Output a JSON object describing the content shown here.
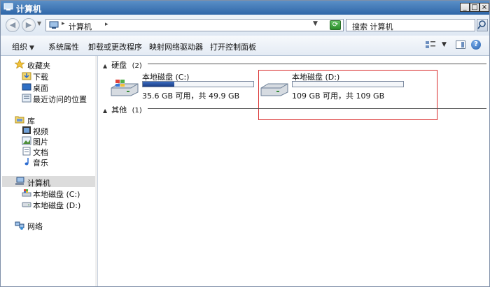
{
  "window": {
    "title": "计算机"
  },
  "address": {
    "path": "计算机"
  },
  "search": {
    "placeholder": "搜索 计算机"
  },
  "toolbar": {
    "organize": "组织",
    "system_properties": "系统属性",
    "uninstall": "卸载或更改程序",
    "map_drive": "映射网络驱动器",
    "control_panel": "打开控制面板"
  },
  "nav": {
    "favorites": {
      "label": "收藏夹",
      "items": [
        "下载",
        "桌面",
        "最近访问的位置"
      ]
    },
    "libraries": {
      "label": "库",
      "items": [
        "视频",
        "图片",
        "文档",
        "音乐"
      ]
    },
    "computer": {
      "label": "计算机",
      "items": [
        "本地磁盘 (C:)",
        "本地磁盘 (D:)"
      ]
    },
    "network": {
      "label": "网络"
    }
  },
  "sections": {
    "hdd": {
      "label": "硬盘",
      "count": "(2)"
    },
    "other": {
      "label": "其他",
      "count": "(1)"
    }
  },
  "drives": [
    {
      "name": "本地磁盘 (C:)",
      "info": "35.6 GB 可用，共 49.9 GB",
      "used_fraction": 0.287
    },
    {
      "name": "本地磁盘 (D:)",
      "info": "109 GB 可用，共 109 GB",
      "used_fraction": 0.0
    }
  ],
  "colors": {
    "highlight": "#d92b2b",
    "titlebar": "#2f66a8"
  }
}
